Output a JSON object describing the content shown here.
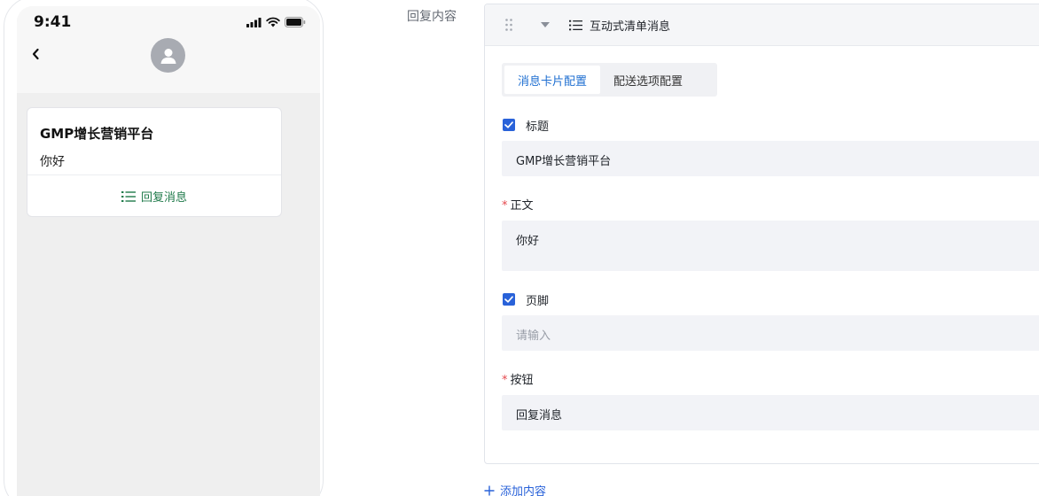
{
  "preview": {
    "status_time": "9:41",
    "card_title": "GMP增长营销平台",
    "card_body": "你好",
    "card_action": "回复消息"
  },
  "form": {
    "section_label": "回复内容",
    "panel_title": "互动式清单消息",
    "tabs": [
      {
        "label": "消息卡片配置",
        "active": true
      },
      {
        "label": "配送选项配置",
        "active": false
      }
    ],
    "title_field": {
      "label": "标题",
      "checked": true,
      "value": "GMP增长营销平台"
    },
    "body_field": {
      "label": "正文",
      "required": true,
      "value": "你好"
    },
    "footer_field": {
      "label": "页脚",
      "checked": true,
      "placeholder": "请输入"
    },
    "button_field": {
      "label": "按钮",
      "required": true,
      "value": "回复消息"
    },
    "add_content": "添加内容"
  },
  "colors": {
    "accent_blue": "#2962d9",
    "tab_active": "#1f6fd1",
    "reply_green": "#1f7a4a",
    "required_red": "#e5484d"
  },
  "icons": [
    "back-icon",
    "avatar-icon",
    "signal-icon",
    "wifi-icon",
    "battery-icon",
    "list-icon",
    "drag-handle-icon",
    "caret-down-icon",
    "check-icon",
    "plus-icon"
  ]
}
